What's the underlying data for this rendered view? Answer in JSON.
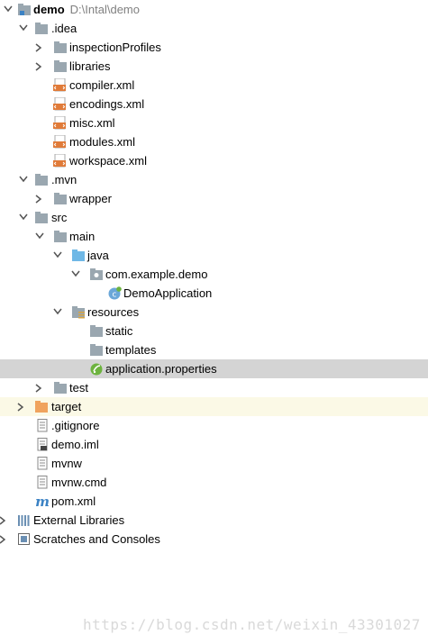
{
  "project": {
    "name": "demo",
    "path": "D:\\Intal\\demo"
  },
  "items": {
    "idea": ".idea",
    "inspection_profiles": "inspectionProfiles",
    "libraries": "libraries",
    "compiler": "compiler.xml",
    "encodings": "encodings.xml",
    "misc": "misc.xml",
    "modules": "modules.xml",
    "workspace": "workspace.xml",
    "mvn": ".mvn",
    "wrapper": "wrapper",
    "src": "src",
    "main": "main",
    "java": "java",
    "package": "com.example.demo",
    "demo_application": "DemoApplication",
    "resources": "resources",
    "static": "static",
    "templates": "templates",
    "app_properties": "application.properties",
    "test": "test",
    "target": "target",
    "gitignore": ".gitignore",
    "demo_iml": "demo.iml",
    "mvnw": "mvnw",
    "mvnw_cmd": "mvnw.cmd",
    "pom": "pom.xml",
    "external_libraries": "External Libraries",
    "scratches": "Scratches and Consoles"
  },
  "watermark": "https://blog.csdn.net/weixin_43301027",
  "colors": {
    "folder": "#9aa7b0",
    "source_folder": "#6fb8e6",
    "excluded_folder": "#f0a35e",
    "xml_icon": "#e07b39",
    "selection": "#d4d4d4",
    "maven_m": "#3b82c4"
  }
}
